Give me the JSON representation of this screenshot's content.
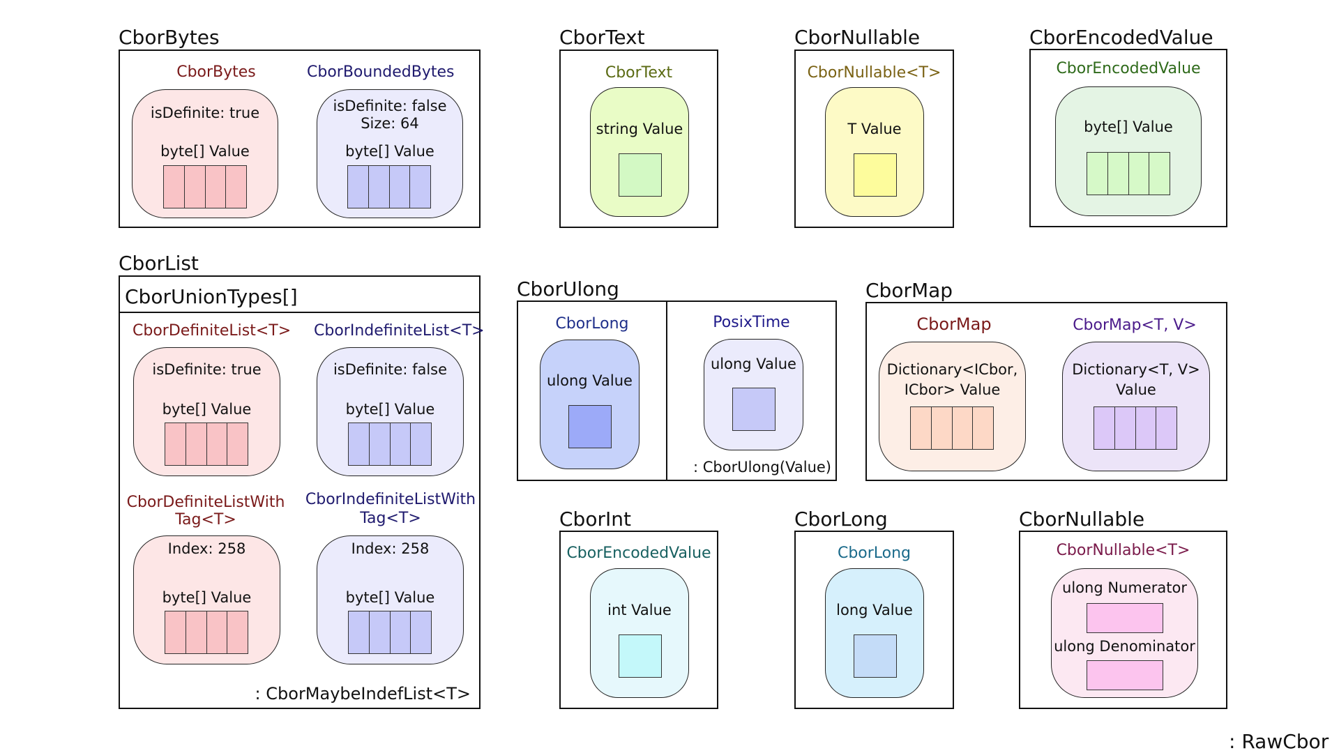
{
  "colors": {
    "red_title": "#7a1a1a",
    "navy_title": "#1f1a6e",
    "olive_title": "#5a6a12",
    "gold_title": "#7a6214",
    "green_title": "#2e6a1a",
    "blue_title": "#1f2f8a",
    "purple_title": "#4a1a8a",
    "teal_title": "#176060",
    "sky_title": "#1a6a8a",
    "magenta_title": "#7a1a4a"
  },
  "cbor_bytes": {
    "title": "CborBytes",
    "left": {
      "subtitle": "CborBytes",
      "line1": "isDefinite: true",
      "line2": "byte[] Value"
    },
    "right": {
      "subtitle": "CborBoundedBytes",
      "line1": "isDefinite: false",
      "line1b": "Size: 64",
      "line2": "byte[] Value"
    }
  },
  "cbor_text": {
    "title": "CborText",
    "subtitle": "CborText",
    "line1": "string Value"
  },
  "cbor_nullable_top": {
    "title": "CborNullable",
    "subtitle": "CborNullable<T>",
    "line1": "T Value"
  },
  "cbor_encoded_value": {
    "title": "CborEncodedValue",
    "subtitle": "CborEncodedValue",
    "line1": "byte[] Value"
  },
  "cbor_list": {
    "title": "CborList",
    "header": "CborUnionTypes[]",
    "footer": ": CborMaybeIndefList<T>",
    "cards": [
      {
        "subtitle": "CborDefiniteList<T>",
        "line1": "isDefinite: true",
        "line2": "byte[] Value"
      },
      {
        "subtitle": "CborIndefiniteList<T>",
        "line1": "isDefinite: false",
        "line2": "byte[] Value"
      },
      {
        "subtitle1": "CborDefiniteListWith",
        "subtitle2": "Tag<T>",
        "line1": "Index: 258",
        "line2": "byte[] Value"
      },
      {
        "subtitle1": "CborIndefiniteListWith",
        "subtitle2": "Tag<T>",
        "line1": "Index: 258",
        "line2": "byte[] Value"
      }
    ]
  },
  "cbor_ulong": {
    "title": "CborUlong",
    "left": {
      "subtitle": "CborLong",
      "line1": "ulong Value"
    },
    "right": {
      "subtitle": "PosixTime",
      "line1": "ulong Value",
      "footer": ": CborUlong(Value)"
    }
  },
  "cbor_map": {
    "title": "CborMap",
    "left": {
      "subtitle": "CborMap",
      "line1": "Dictionary<ICbor,",
      "line2": "ICbor> Value"
    },
    "right": {
      "subtitle": "CborMap<T, V>",
      "line1": "Dictionary<T, V>",
      "line2": "Value"
    }
  },
  "cbor_int": {
    "title": "CborInt",
    "subtitle": "CborEncodedValue",
    "line1": "int Value"
  },
  "cbor_long": {
    "title": "CborLong",
    "subtitle": "CborLong",
    "line1": "long Value"
  },
  "cbor_nullable_bottom": {
    "title": "CborNullable",
    "subtitle": "CborNullable<T>",
    "line1": "ulong Numerator",
    "line2": "ulong Denominator"
  },
  "raw_cbor_label": ": RawCbor"
}
